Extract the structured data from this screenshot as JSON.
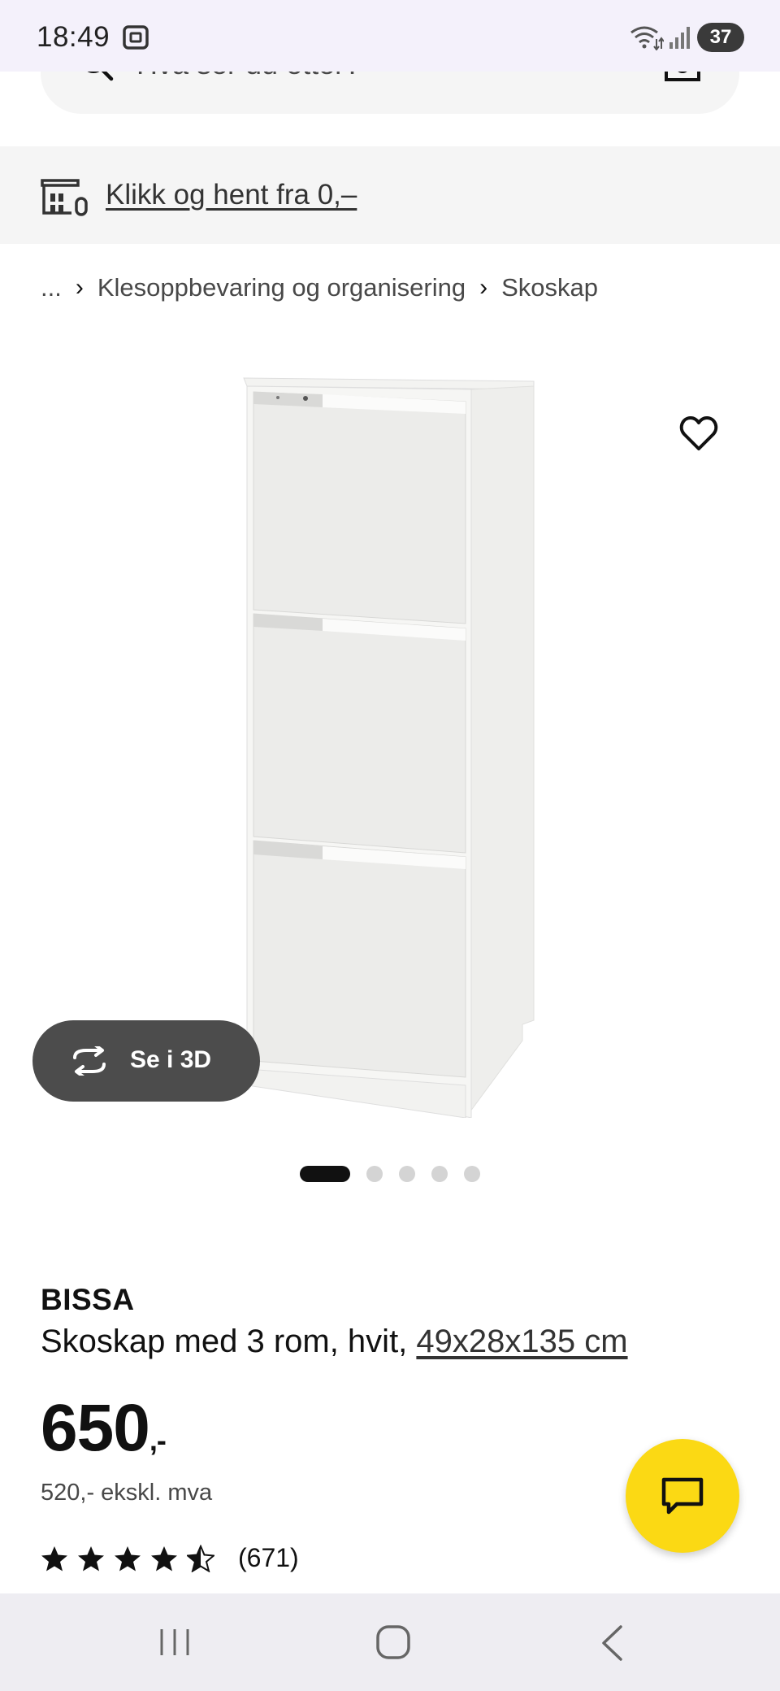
{
  "status_bar": {
    "time": "18:49",
    "battery": "37"
  },
  "search": {
    "placeholder": "Hva ser du etter?"
  },
  "pickup_banner": {
    "link": "Klikk og hent fra 0,–"
  },
  "breadcrumb": {
    "items": [
      "...",
      "Klesoppbevaring og organisering",
      "Skoskap"
    ]
  },
  "gallery": {
    "view_3d_label": "Se i 3D",
    "total_images": 5,
    "active_index": 0
  },
  "product": {
    "name": "BISSA",
    "description": "Skoskap med 3 rom, hvit, ",
    "dimensions": "49x28x135 cm",
    "price": "650",
    "price_suffix": ",-",
    "price_ex_vat": "520,- ekskl. mva",
    "rating": 4.5,
    "review_count": "(671)"
  },
  "colors": {
    "chat_button": "#fbd914",
    "text": "#111111",
    "secondary_text": "#484848"
  },
  "icons": {
    "search": "search-icon",
    "camera": "camera-icon",
    "store": "store-icon",
    "favorite": "heart-icon",
    "rotate_3d": "rotate-3d-icon",
    "chat": "chat-icon"
  }
}
